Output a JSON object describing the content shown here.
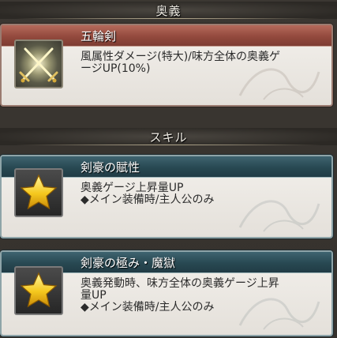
{
  "sections": {
    "ougi_label": "奥義",
    "skill_label": "スキル"
  },
  "ougi": {
    "name": "五輪剣",
    "desc_line1": "風属性ダメージ(特大)/味方全体の奥義ゲ",
    "desc_line2": "ージUP(10%)",
    "icon": "crossed-swords-icon",
    "accent": "#93493d"
  },
  "skills": [
    {
      "name": "剣豪の賦性",
      "desc_line1": "奥義ゲージ上昇量UP",
      "desc_line2": "◆メイン装備時/主人公のみ",
      "icon": "star-icon",
      "accent": "#284852"
    },
    {
      "name": "剣豪の極み・魔獄",
      "desc_line1": "奥義発動時、味方全体の奥義ゲージ上昇",
      "desc_line2": "量UP",
      "desc_line3": "◆メイン装備時/主人公のみ",
      "icon": "star-icon",
      "accent": "#284852"
    }
  ]
}
